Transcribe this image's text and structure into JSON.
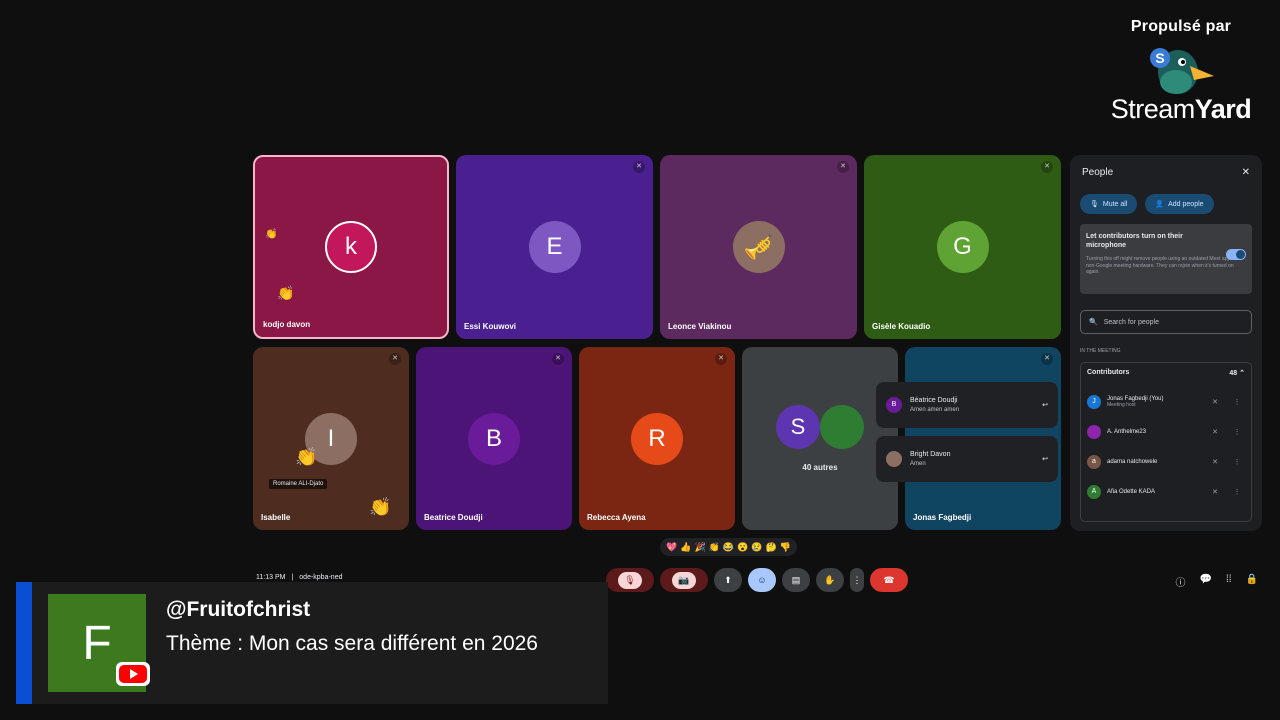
{
  "branding": {
    "powered_by": "Propulsé par",
    "wordmark_light": "Stream",
    "wordmark_bold": "Yard",
    "badge_count": "48"
  },
  "tiles": [
    {
      "name": "kodjo davon",
      "initial": "k",
      "bg": "#8a1745",
      "avatar": "#c2185b"
    },
    {
      "name": "Essi Kouwovi",
      "initial": "E",
      "bg": "#4a2090",
      "avatar": "#7e57c2"
    },
    {
      "name": "Leonce Viakinou",
      "initial": "",
      "bg": "#5c2a5e",
      "avatar": "#8d6e63"
    },
    {
      "name": "Gisèle Kouadio",
      "initial": "G",
      "bg": "#2f5c14",
      "avatar": "#5fa335"
    },
    {
      "name": "Isabelle",
      "initial": "I",
      "bg": "#4e2c20",
      "avatar": "#8d6e63",
      "hover_label": "Romaine ALI-Djato"
    },
    {
      "name": "Beatrice Doudji",
      "initial": "B",
      "bg": "#4d1478",
      "avatar": "#6a1b9a"
    },
    {
      "name": "Rebecca Ayena",
      "initial": "R",
      "bg": "#7a2612",
      "avatar": "#e64a19"
    },
    {
      "name": "",
      "initial": "S",
      "bg": "#3c4043",
      "avatar": "#5e35b1",
      "others": "40 autres"
    },
    {
      "name": "Jonas Fagbedji",
      "initial": "",
      "bg": "#0f4560",
      "avatar": "#0f4560"
    }
  ],
  "chat_popups": [
    {
      "initial": "B",
      "name": "Béatrice Doudji",
      "message": "Amen amen amen",
      "avatar": "#6a1b9a"
    },
    {
      "initial": "",
      "name": "Bright Davon",
      "message": "Amen",
      "avatar": "#8d6e63"
    }
  ],
  "people": {
    "title": "People",
    "mute_all": "Mute all",
    "add_people": "Add people",
    "notice_title": "Let contributors turn on their microphone",
    "notice_desc": "Turning this off might remove people using an outdated Meet app or non-Google meeting hardware. They can rejoin when it's turned on again.",
    "search_placeholder": "Search for people",
    "section": "IN THE MEETING",
    "contributors_label": "Contributors",
    "contributors_count": "48",
    "rows": [
      {
        "initial": "J",
        "name": "Jonas Fagbedji (You)",
        "sub": "Meeting host",
        "avatar": "#1976d2"
      },
      {
        "initial": "",
        "name": "A. Anthelme23",
        "sub": "",
        "avatar": "#8e24aa"
      },
      {
        "initial": "a",
        "name": "adama natchowele",
        "sub": "",
        "avatar": "#795548"
      },
      {
        "initial": "A",
        "name": "Afia Odette KADA",
        "sub": "",
        "avatar": "#2e7d32"
      }
    ]
  },
  "reactions": [
    "💖",
    "👍",
    "🎉",
    "👏",
    "😂",
    "😮",
    "😢",
    "🤔",
    "👎"
  ],
  "meeting_info": {
    "time": "11:13 PM",
    "separator": "|",
    "code": "ode-kpba-ned"
  },
  "lower_third": {
    "initial": "F",
    "handle": "@Fruitofchrist",
    "theme": "Thème : Mon cas sera différent en 2026"
  }
}
